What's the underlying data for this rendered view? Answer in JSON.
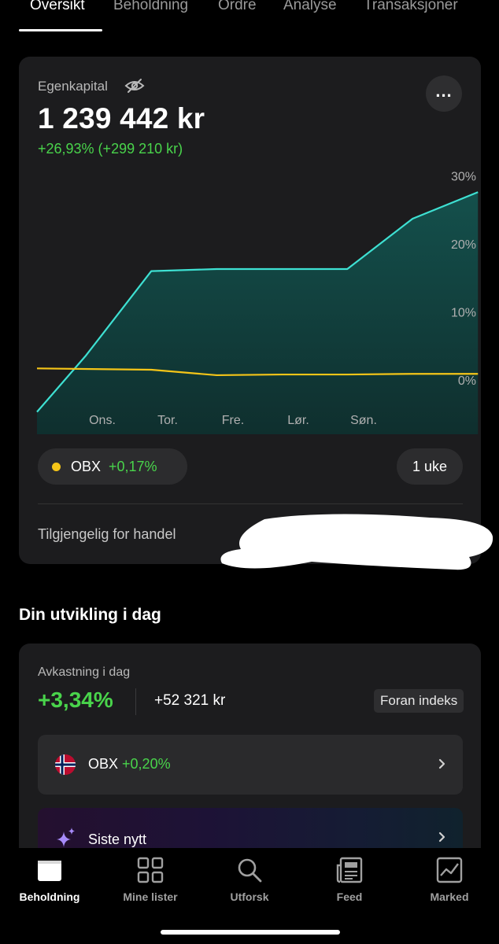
{
  "tabs": [
    {
      "label": "Oversikt",
      "active": true
    },
    {
      "label": "Beholdning",
      "active": false
    },
    {
      "label": "Ordre",
      "active": false
    },
    {
      "label": "Analyse",
      "active": false
    },
    {
      "label": "Transaksjoner",
      "active": false
    }
  ],
  "equity": {
    "label": "Egenkapital",
    "value": "1 239 442 kr",
    "change": "+26,93% (+299 210 kr)"
  },
  "chart_data": {
    "type": "area",
    "categories": [
      "Ons.",
      "Tor.",
      "Fre.",
      "Lør.",
      "Søn."
    ],
    "y_tick_labels": [
      "30%",
      "20%",
      "10%",
      "0%"
    ],
    "y_ticks": [
      30,
      20,
      10,
      0
    ],
    "ylim": [
      -5,
      30
    ],
    "series": [
      {
        "x": [
          -1.0,
          -0.25,
          0.75,
          1.75,
          2.75,
          3.75,
          4.75,
          5.75
        ],
        "values": [
          -4.7,
          3.6,
          16.0,
          16.3,
          16.3,
          16.3,
          23.7,
          27.6
        ],
        "color": "#3ee0d2",
        "fill": "#12413f"
      },
      {
        "x": [
          -1.0,
          0.75,
          1.75,
          2.75,
          3.75,
          4.75,
          5.75
        ],
        "values": [
          1.7,
          1.5,
          0.7,
          0.8,
          0.8,
          0.9,
          0.9
        ],
        "color": "#f5c518"
      }
    ],
    "legend": {
      "name": "OBX",
      "change": "+0,17%",
      "color": "#f5c518",
      "placement": "bottom-left"
    },
    "period": "1 uke",
    "grid": false
  },
  "available_label": "Tilgjengelig for handel",
  "section_title": "Din utvikling i dag",
  "today": {
    "label": "Avkastning i dag",
    "percent": "+3,34%",
    "amount": "+52 321 kr",
    "badge": "Foran indeks",
    "index_name": "OBX",
    "index_change": "+0,20%",
    "news_label": "Siste nytt"
  },
  "nav": [
    {
      "label": "Beholdning",
      "icon": "wallet-icon",
      "active": true
    },
    {
      "label": "Mine lister",
      "icon": "grid-icon",
      "active": false
    },
    {
      "label": "Utforsk",
      "icon": "search-icon",
      "active": false
    },
    {
      "label": "Feed",
      "icon": "newspaper-icon",
      "active": false
    },
    {
      "label": "Marked",
      "icon": "market-chart-icon",
      "active": false
    }
  ],
  "colors": {
    "positive": "#49d44b",
    "accent_line": "#3ee0d2",
    "index_line": "#f5c518",
    "card": "#1c1c1e"
  }
}
